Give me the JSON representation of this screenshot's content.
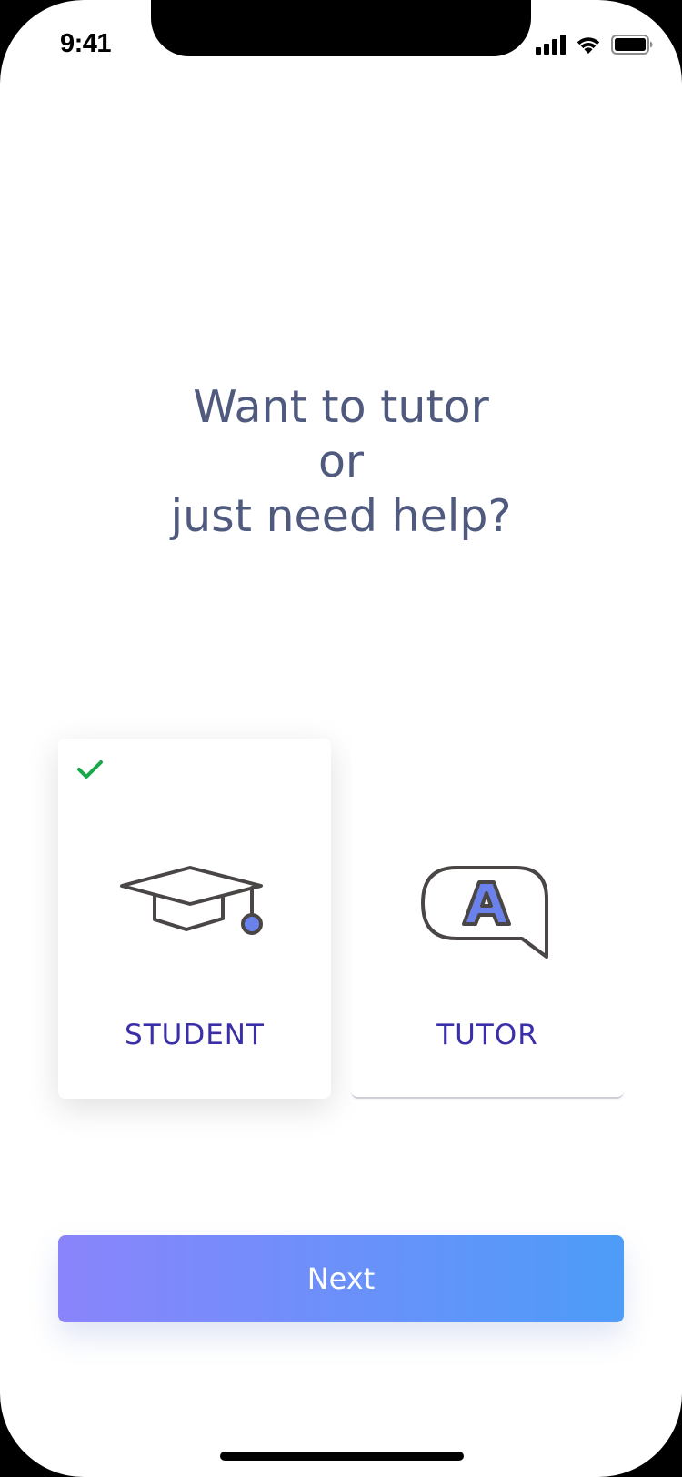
{
  "status_bar": {
    "time": "9:41",
    "icons": [
      "signal-icon",
      "wifi-icon",
      "battery-icon"
    ]
  },
  "question": {
    "line1": "Want to tutor",
    "line2": "or",
    "line3": "just need help?"
  },
  "options": [
    {
      "label": "STUDENT",
      "icon": "graduation-cap-icon",
      "selected": true
    },
    {
      "label": "TUTOR",
      "icon": "speech-bubble-a-icon",
      "selected": false
    }
  ],
  "next_button": {
    "label": "Next"
  },
  "colors": {
    "heading": "#4f5a7e",
    "option_label": "#3a2fa8",
    "check": "#1aa64a",
    "button_gradient_start": "#8a84fb",
    "button_gradient_end": "#4d9cf8",
    "icon_accent": "#6b82ec"
  }
}
